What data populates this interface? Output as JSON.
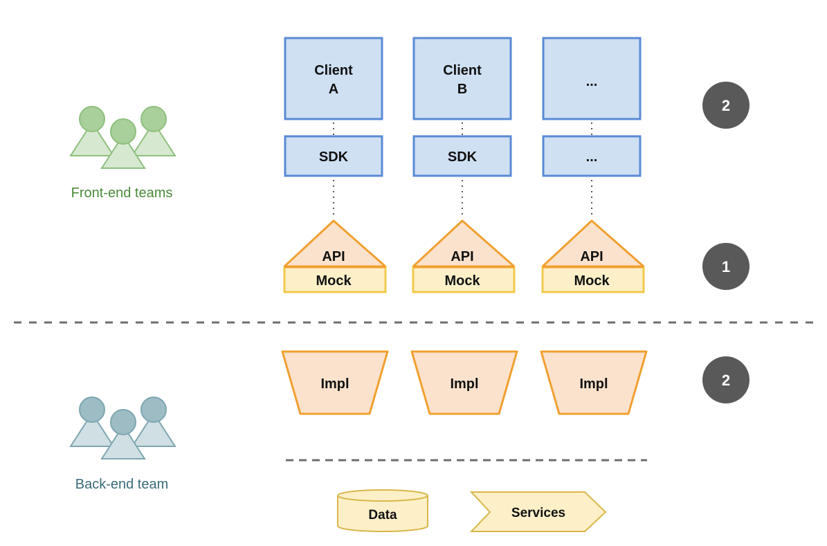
{
  "colors": {
    "client_fill": "#cfe0f3",
    "client_stroke": "#5a8ad6",
    "api_fill": "#fbe2cc",
    "api_stroke": "#f0a030",
    "mock_fill": "#fdf0c8",
    "mock_stroke": "#f2c94c",
    "impl_fill": "#fbe2cc",
    "impl_stroke": "#f0a030",
    "data_fill": "#fdf0c8",
    "data_stroke": "#d9b64a",
    "badge_fill": "#595959",
    "frontend_fill": "#d6e8cf",
    "frontend_head": "#a9cf9b",
    "frontend_stroke": "#8fbf7e",
    "frontend_text": "#4a8a3a",
    "backend_fill": "#cfdfe3",
    "backend_head": "#9dbcc3",
    "backend_stroke": "#7fa6b0",
    "backend_text": "#3a6a78",
    "divider": "#6e6e6e"
  },
  "teams": {
    "frontend": {
      "label": "Front-end teams",
      "icon": "people-group-icon"
    },
    "backend": {
      "label": "Back-end team",
      "icon": "people-group-icon"
    }
  },
  "columns": [
    {
      "client": [
        "Client",
        "A"
      ],
      "sdk": "SDK",
      "api": "API",
      "mock": "Mock",
      "impl": "Impl"
    },
    {
      "client": [
        "Client",
        "B"
      ],
      "sdk": "SDK",
      "api": "API",
      "mock": "Mock",
      "impl": "Impl"
    },
    {
      "client": [
        "..."
      ],
      "sdk": "...",
      "api": "API",
      "mock": "Mock",
      "impl": "Impl"
    }
  ],
  "badges": [
    {
      "label": "2",
      "row": "clients"
    },
    {
      "label": "1",
      "row": "api-mock"
    },
    {
      "label": "2",
      "row": "impl"
    }
  ],
  "bottom": {
    "data": "Data",
    "services": "Services"
  }
}
